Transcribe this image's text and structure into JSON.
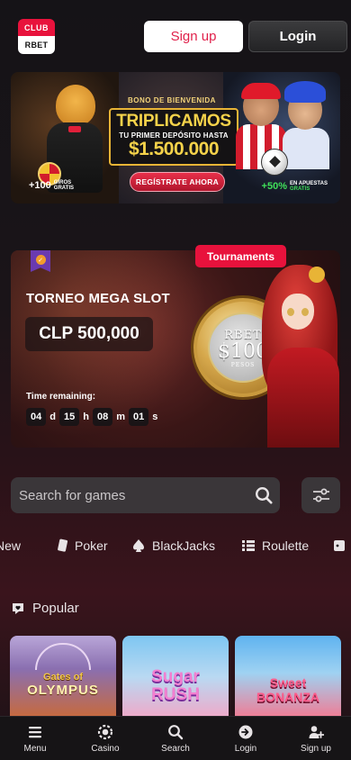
{
  "header": {
    "logo_top": "CLUB",
    "logo_bottom": "RBET",
    "signup_label": "Sign up",
    "login_label": "Login"
  },
  "promo_banner": {
    "bono": "BONO DE BIENVENIDA",
    "headline": "TRIPLICAMOS",
    "subline": "TU PRIMER DEPÓSITO HASTA",
    "amount": "$1.500.000",
    "cta": "REGÍSTRATE AHORA",
    "spins_count": "+100",
    "spins_label_1": "GIROS",
    "spins_label_2": "GRATIS",
    "bonus_pct": "+50%",
    "bonus_label_1": "EN APUESTAS",
    "bonus_label_2": "GRATIS"
  },
  "tournament": {
    "tag": "Tournaments",
    "name": "TORNEO MEGA SLOT",
    "prize": "CLP 500,000",
    "time_label": "Time remaining:",
    "countdown": {
      "days": "04",
      "days_unit": "d",
      "hours": "15",
      "hours_unit": "h",
      "minutes": "08",
      "minutes_unit": "m",
      "seconds": "01",
      "seconds_unit": "s"
    },
    "coin_top": "RBET",
    "coin_value": "$100",
    "coin_sub": "PESOS"
  },
  "search": {
    "placeholder": "Search for games"
  },
  "categories": [
    {
      "label": "New"
    },
    {
      "label": "Poker"
    },
    {
      "label": "BlackJacks"
    },
    {
      "label": "Roulette"
    }
  ],
  "popular": {
    "title": "Popular",
    "games": [
      {
        "title_1": "Gates of",
        "title_2": "OLYMPUS"
      },
      {
        "title_1": "Sugar",
        "title_2": "RUSH"
      },
      {
        "title_1": "Sweet",
        "title_2": "BONANZA"
      }
    ]
  },
  "bottom_nav": [
    {
      "label": "Menu",
      "icon": "menu-icon"
    },
    {
      "label": "Casino",
      "icon": "casino-chip-icon"
    },
    {
      "label": "Search",
      "icon": "search-icon"
    },
    {
      "label": "Login",
      "icon": "login-arrow-icon"
    },
    {
      "label": "Sign up",
      "icon": "add-user-icon"
    }
  ],
  "colors": {
    "brand_red": "#e8123c",
    "banner_gold": "#f5d24a",
    "bonus_green": "#3fe05a"
  }
}
